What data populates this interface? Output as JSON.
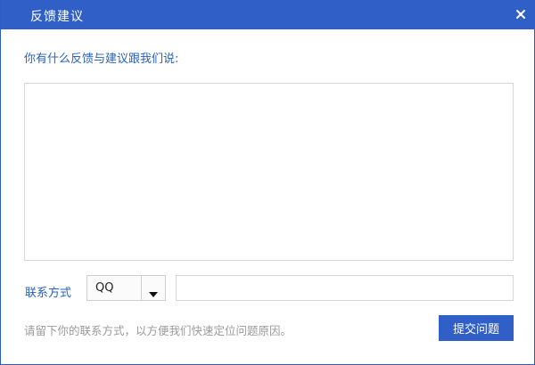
{
  "window": {
    "title": "反馈建议",
    "close_icon": "close-icon"
  },
  "form": {
    "prompt": "你有什么反馈与建议跟我们说:",
    "feedback_value": "",
    "contact_label": "联系方式",
    "contact_type_selected": "QQ",
    "contact_value": "",
    "hint": "请留下你的联系方式，以方便我们快速定位问题原因。",
    "submit_label": "提交问题"
  },
  "colors": {
    "title_bar": "#2f5fc7",
    "label_text": "#2a62b8",
    "hint_text": "#9a9a9a",
    "button_bg": "#2f5fc7"
  }
}
